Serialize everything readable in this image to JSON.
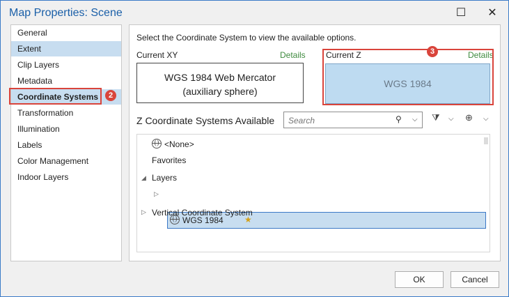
{
  "window": {
    "title": "Map Properties: Scene",
    "maximize_symbol": "☐",
    "close_symbol": "✕"
  },
  "sidebar": {
    "items": [
      {
        "label": "General"
      },
      {
        "label": "Extent"
      },
      {
        "label": "Clip Layers"
      },
      {
        "label": "Metadata"
      },
      {
        "label": "Coordinate Systems"
      },
      {
        "label": "Transformation"
      },
      {
        "label": "Illumination"
      },
      {
        "label": "Labels"
      },
      {
        "label": "Color Management"
      },
      {
        "label": "Indoor Layers"
      }
    ],
    "selected_index": 4
  },
  "annotations": {
    "badge_2": "2",
    "badge_3": "3",
    "highlight_color": "#d9443b"
  },
  "main": {
    "instruction": "Select the Coordinate System to view the available options.",
    "current_xy": {
      "label": "Current XY",
      "details": "Details",
      "line1": "WGS 1984 Web Mercator",
      "line2": "(auxiliary sphere)"
    },
    "current_z": {
      "label": "Current Z",
      "details": "Details",
      "value": "WGS 1984"
    },
    "available_title": "Z Coordinate Systems Available",
    "search": {
      "placeholder": "Search",
      "icon": "search-icon"
    },
    "tree": {
      "none": "<None>",
      "favorites": "Favorites",
      "layers": "Layers",
      "layer_item": "WGS 1984",
      "vertical": "Vertical Coordinate System"
    }
  },
  "footer": {
    "ok": "OK",
    "cancel": "Cancel"
  }
}
